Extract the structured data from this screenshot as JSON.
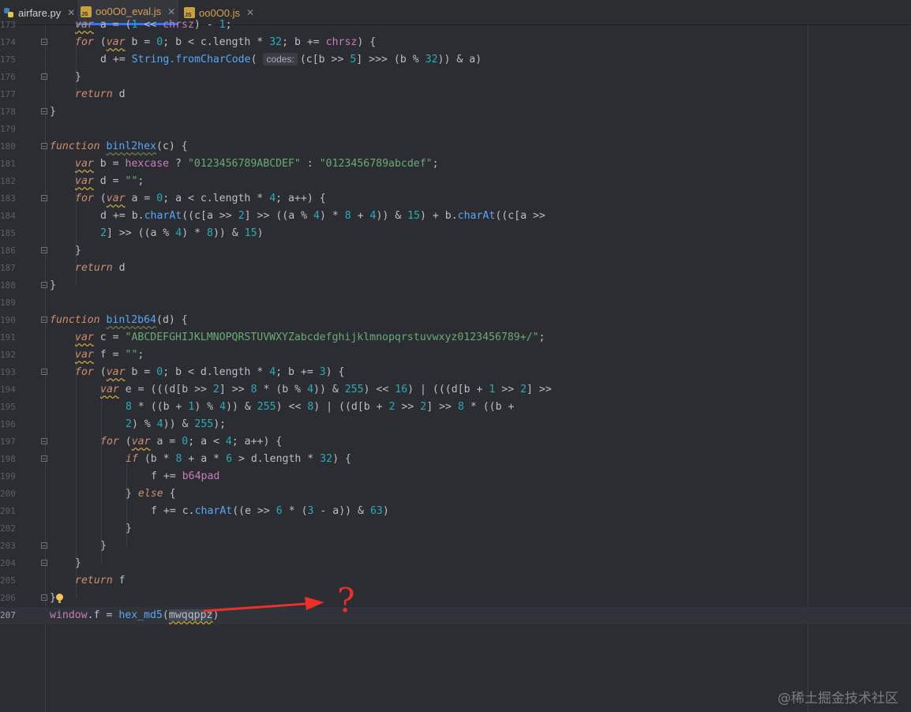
{
  "tabs": [
    {
      "label": "airfare.py",
      "icon": "python-file-icon",
      "active": false
    },
    {
      "label": "oo0O0_eval.js",
      "icon": "javascript-file-icon",
      "active": true
    },
    {
      "label": "oo0O0.js",
      "icon": "javascript-file-icon",
      "active": false
    }
  ],
  "editor": {
    "language": "javascript",
    "line_numbers": [
      "173",
      "174",
      "175",
      "176",
      "177",
      "178",
      "179",
      "180",
      "181",
      "182",
      "183",
      "184",
      "185",
      "186",
      "187",
      "188",
      "189",
      "190",
      "191",
      "192",
      "193",
      "194",
      "195",
      "196",
      "197",
      "198",
      "199",
      "200",
      "201",
      "202",
      "203",
      "204",
      "205",
      "206",
      "207"
    ],
    "lines": [
      "var a = (1 << chrsz) - 1;",
      "for (var b = 0; b < c.length * 32; b += chrsz) {",
      "d += String.fromCharCode( codes: (c[b >> 5] >>> (b % 32)) & a)",
      "}",
      "return d",
      "}",
      "",
      "function binl2hex(c) {",
      "var b = hexcase ? \"0123456789ABCDEF\" : \"0123456789abcdef\";",
      "var d = \"\";",
      "for (var a = 0; a < c.length * 4; a++) {",
      "d += b.charAt((c[a >> 2] >> ((a % 4) * 8 + 4)) & 15) + b.charAt((c[a >>",
      "2] >> ((a % 4) * 8)) & 15)",
      "}",
      "return d",
      "}",
      "",
      "function binl2b64(d) {",
      "var c = \"ABCDEFGHIJKLMNOPQRSTUVWXYZabcdefghijklmnopqrstuvwxyz0123456789+/\";",
      "var f = \"\";",
      "for (var b = 0; b < d.length * 4; b += 3) {",
      "var e = (((d[b >> 2] >> 8 * (b % 4)) & 255) << 16) | (((d[b + 1 >> 2] >>",
      "8 * ((b + 1) % 4)) & 255) << 8) | ((d[b + 2 >> 2] >> 8 * ((b +",
      "2) % 4)) & 255);",
      "for (var a = 0; a < 4; a++) {",
      "if (b * 8 + a * 6 > d.length * 32) {",
      "f += b64pad",
      "} else {",
      "f += c.charAt((e >> 6 * (3 - a)) & 63)",
      "}",
      "}",
      "}",
      "return f",
      "}",
      "window.f = hex_md5(mwqqppz)"
    ],
    "inlay_hint": "codes:"
  },
  "annotation": {
    "question_mark": "?",
    "arrow_color": "#e8312b"
  },
  "watermark": "@稀土掘金技术社区",
  "colors": {
    "background": "#2b2d33",
    "keyword": "#cf8e6d",
    "function": "#56a8f5",
    "string": "#6aab73",
    "number": "#2aacb8",
    "global": "#c77dbb"
  }
}
